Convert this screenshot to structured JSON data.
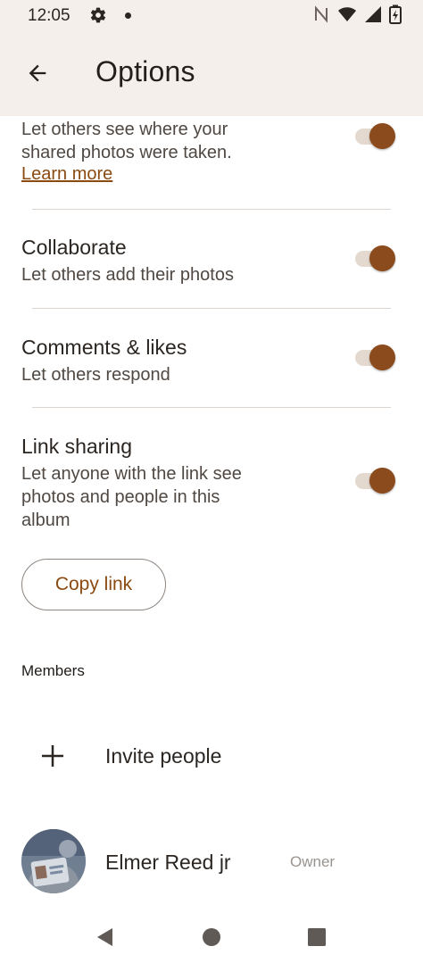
{
  "status": {
    "time": "12:05"
  },
  "header": {
    "title": "Options"
  },
  "settings": {
    "location": {
      "description": "Let others see where your shared photos were taken.",
      "link": "Learn more",
      "enabled": true
    },
    "collaborate": {
      "title": "Collaborate",
      "description": "Let others add their photos",
      "enabled": true
    },
    "comments": {
      "title": "Comments & likes",
      "description": "Let others respond",
      "enabled": true
    },
    "link_sharing": {
      "title": "Link sharing",
      "description": "Let anyone with the link see photos and people in this album",
      "enabled": true
    }
  },
  "copy_link_label": "Copy link",
  "members": {
    "heading": "Members",
    "invite_label": "Invite people",
    "list": [
      {
        "name": "Elmer Reed jr",
        "role": "Owner"
      }
    ]
  },
  "colors": {
    "accent": "#8b4b1c",
    "track": "#e4d9cf",
    "header_bg": "#f4efea",
    "link": "#8a4a10"
  },
  "icons": [
    "gear-icon",
    "nfc-icon",
    "wifi-icon",
    "signal-icon",
    "battery-icon",
    "back-arrow-icon",
    "plus-icon",
    "nav-back-icon",
    "nav-home-icon",
    "nav-recents-icon"
  ]
}
